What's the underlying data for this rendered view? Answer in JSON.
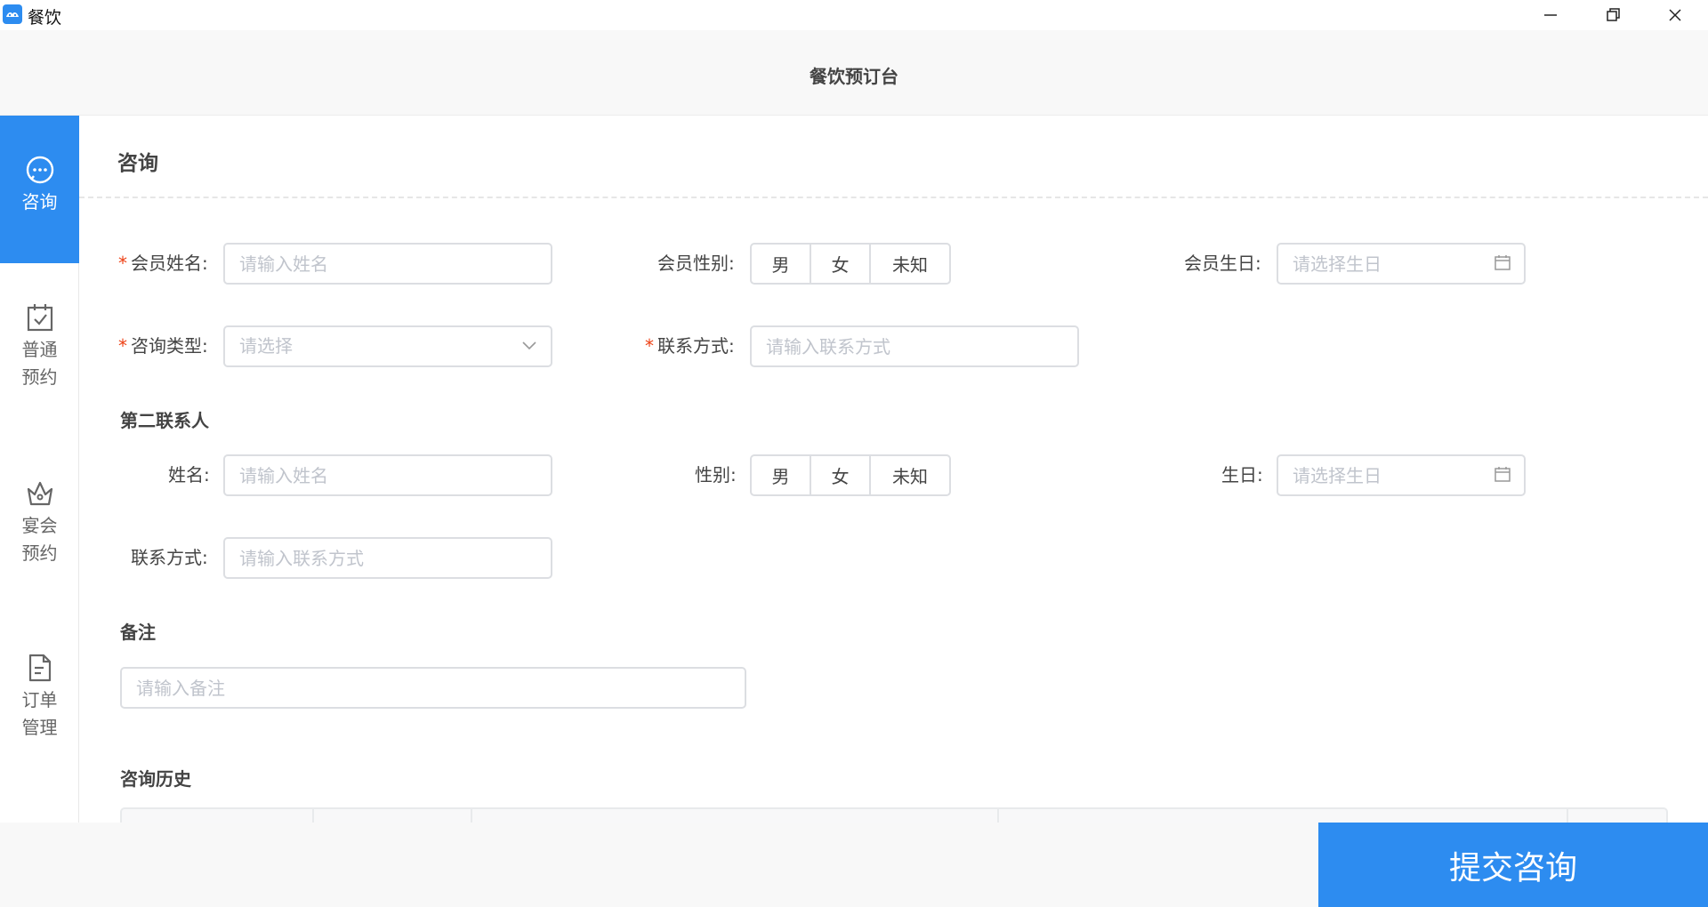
{
  "window": {
    "title": "餐饮"
  },
  "header": {
    "title": "餐饮预订台"
  },
  "sidebar": {
    "items": [
      {
        "icon": "chat-icon",
        "label": "咨询",
        "active": true
      },
      {
        "icon": "calendar-check-icon",
        "label": "普通\n预约",
        "line1": "普通",
        "line2": "预约"
      },
      {
        "icon": "crown-icon",
        "label": "宴会\n预约",
        "line1": "宴会",
        "line2": "预约"
      },
      {
        "icon": "document-icon",
        "label": "订单\n管理",
        "line1": "订单",
        "line2": "管理"
      }
    ]
  },
  "main": {
    "section_title": "咨询",
    "member": {
      "name_label": "会员姓名:",
      "name_placeholder": "请输入姓名",
      "gender_label": "会员性别:",
      "gender_options": [
        "男",
        "女",
        "未知"
      ],
      "birthday_label": "会员生日:",
      "birthday_placeholder": "请选择生日",
      "type_label": "咨询类型:",
      "type_placeholder": "请选择",
      "contact_label": "联系方式:",
      "contact_placeholder": "请输入联系方式"
    },
    "second_contact": {
      "title": "第二联系人",
      "name_label": "姓名:",
      "name_placeholder": "请输入姓名",
      "gender_label": "性别:",
      "gender_options": [
        "男",
        "女",
        "未知"
      ],
      "birthday_label": "生日:",
      "birthday_placeholder": "请选择生日",
      "contact_label": "联系方式:",
      "contact_placeholder": "请输入联系方式"
    },
    "remark": {
      "title": "备注",
      "placeholder": "请输入备注"
    },
    "history": {
      "title": "咨询历史"
    },
    "required_mark": "*"
  },
  "footer": {
    "submit_label": "提交咨询"
  },
  "colors": {
    "accent": "#2d8cf0",
    "required": "#ed4014",
    "border": "#dcdee2"
  }
}
